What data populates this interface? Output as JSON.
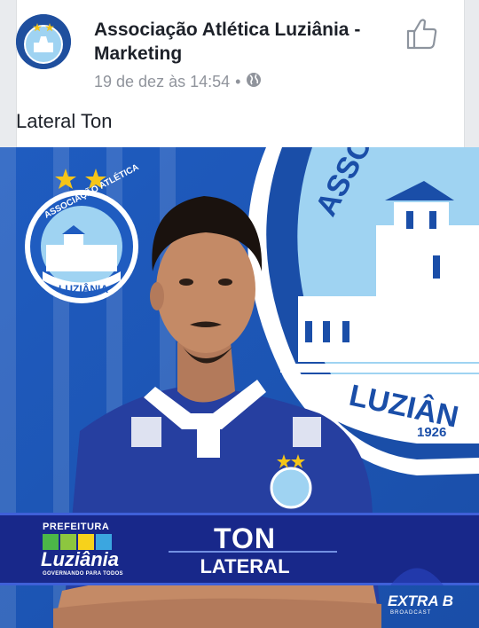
{
  "post": {
    "page_name": "Associação Atlética Luziânia - Marketing",
    "timestamp": "19 de dez às 14:54",
    "separator": "•",
    "privacy_icon": "globe-icon",
    "like_icon": "thumbs-up-icon",
    "caption": "Lateral Ton"
  },
  "photo": {
    "banner_name": "TON",
    "banner_position": "LATERAL",
    "crest_ring_text": "ASSOCIAÇÃO ATLÉTICA",
    "crest_city_text": "LUZIÂNIA",
    "crest_year": "1926",
    "large_crest_ring_text": "ASSOC",
    "large_crest_city_text": "LUZIÂN",
    "sponsor_top": "PREFEITURA",
    "sponsor_main": "Luziânia",
    "sponsor_sub": "GOVERNANDO PARA TODOS",
    "watermark": "EXTRA B",
    "watermark_sub": "BROADCAST"
  },
  "colors": {
    "photo_bg": "#1b56b8",
    "jersey": "#263fa0",
    "banner": "#18288a",
    "star": "#f5c518",
    "crest_light": "#9fd3f2"
  }
}
